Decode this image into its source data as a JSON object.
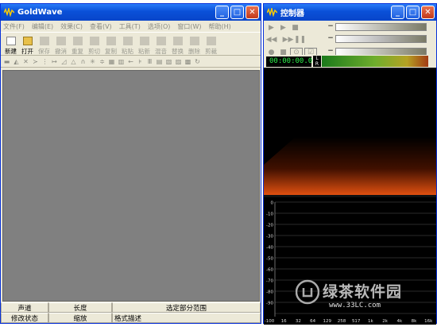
{
  "goldwave": {
    "title": "GoldWave",
    "menu": [
      "文件(F)",
      "编辑(E)",
      "效果(C)",
      "查看(V)",
      "工具(T)",
      "选项(O)",
      "窗口(W)",
      "帮助(H)"
    ],
    "tools": [
      "新建",
      "打开",
      "保存",
      "撤消",
      "重复",
      "剪切",
      "复制",
      "粘贴",
      "粘新",
      "混音",
      "替换",
      "删除",
      "剪裁"
    ],
    "status": {
      "channel": "声道",
      "length": "长度",
      "selection": "选定部分范围",
      "modified": "修改状态",
      "zoom": "缩放",
      "format": "格式描述"
    }
  },
  "controller": {
    "title": "控制器",
    "time": "00:00:00.0",
    "meter_labels": [
      "L",
      "R"
    ],
    "db_labels": [
      "0",
      "-10",
      "-20",
      "-30",
      "-40",
      "-50",
      "-60",
      "-70",
      "-80",
      "-90",
      "-100"
    ],
    "freq_labels": [
      "-100",
      "16",
      "32",
      "64",
      "129",
      "258",
      "517",
      "1k",
      "2k",
      "4k",
      "8k",
      "16k"
    ]
  },
  "watermark": {
    "text": "绿茶软件园",
    "url": "www.33LC.com"
  }
}
